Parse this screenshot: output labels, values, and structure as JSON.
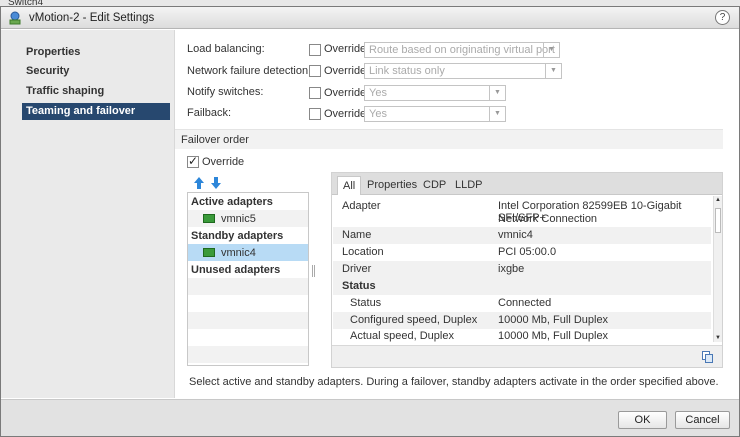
{
  "background_window": {
    "title_fragment": "Switch4"
  },
  "dialog": {
    "title": "vMotion-2 - Edit Settings",
    "help": "?"
  },
  "sidebar": {
    "items": [
      {
        "label": "Properties",
        "selected": false
      },
      {
        "label": "Security",
        "selected": false
      },
      {
        "label": "Traffic shaping",
        "selected": false
      },
      {
        "label": "Teaming and failover",
        "selected": true
      }
    ]
  },
  "settings": {
    "load_balancing": {
      "label": "Load balancing:",
      "override_label": "Override",
      "override": false,
      "value": "Route based on originating virtual port"
    },
    "network_failure_detection": {
      "label": "Network failure detection:",
      "override_label": "Override",
      "override": false,
      "value": "Link status only"
    },
    "notify_switches": {
      "label": "Notify switches:",
      "override_label": "Override",
      "override": false,
      "value": "Yes"
    },
    "failback": {
      "label": "Failback:",
      "override_label": "Override",
      "override": false,
      "value": "Yes"
    }
  },
  "failover_order": {
    "section_title": "Failover order",
    "override_label": "Override",
    "override": true,
    "move_up_icon": "arrow-up-icon",
    "move_down_icon": "arrow-down-icon",
    "groups": {
      "active": {
        "heading": "Active adapters",
        "adapters": [
          "vmnic5"
        ]
      },
      "standby": {
        "heading": "Standby adapters",
        "adapters": [
          "vmnic4"
        ]
      },
      "unused": {
        "heading": "Unused adapters",
        "adapters": []
      }
    },
    "selected_adapter": "vmnic4"
  },
  "details": {
    "tabs": [
      "All",
      "Properties",
      "CDP",
      "LLDP"
    ],
    "active_tab": "All",
    "rows": [
      {
        "key": "Adapter",
        "value": "Intel Corporation 82599EB 10-Gigabit SFI/SFP+",
        "value2": "Network Connection"
      },
      {
        "key": "Name",
        "value": "vmnic4"
      },
      {
        "key": "Location",
        "value": "PCI 05:00.0"
      },
      {
        "key": "Driver",
        "value": "ixgbe"
      }
    ],
    "status_heading": "Status",
    "status_rows": [
      {
        "key": "Status",
        "value": "Connected"
      },
      {
        "key": "Configured speed, Duplex",
        "value": "10000 Mb, Full Duplex"
      },
      {
        "key": "Actual speed, Duplex",
        "value": "10000 Mb, Full Duplex"
      }
    ]
  },
  "footnote": "Select active and standby adapters. During a failover, standby adapters activate in the order specified above.",
  "buttons": {
    "ok": "OK",
    "cancel": "Cancel"
  }
}
